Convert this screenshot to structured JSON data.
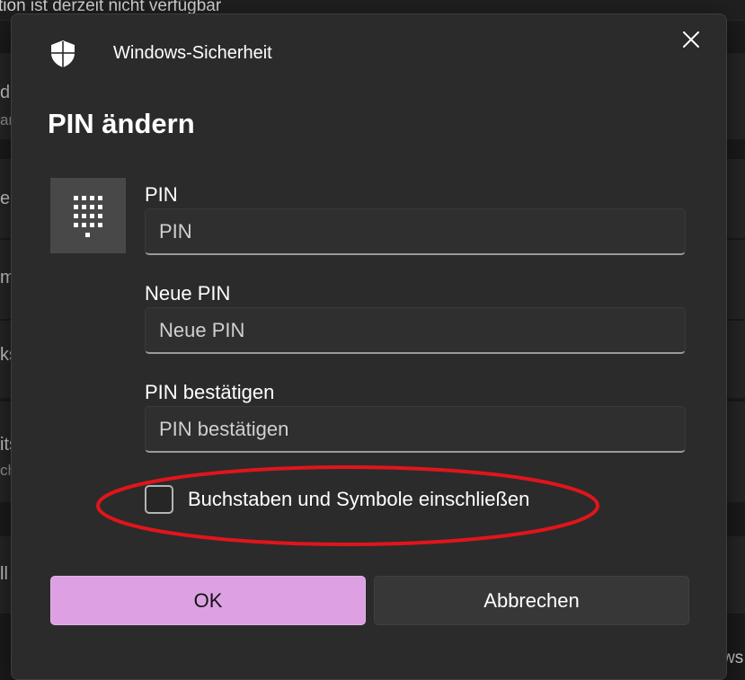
{
  "background": {
    "top_text": "tion ist derzeit nicht verfügbar",
    "fragments": [
      "d",
      "an",
      "er",
      "m",
      "ks",
      "its",
      "ch",
      "ll"
    ],
    "bottom_right_text": "ws"
  },
  "dialog": {
    "app_title": "Windows-Sicherheit",
    "heading": "PIN ändern",
    "icons": {
      "app": "shield-icon",
      "close": "close-icon",
      "keypad": "keypad-icon"
    },
    "fields": [
      {
        "label": "PIN",
        "placeholder": "PIN",
        "value": ""
      },
      {
        "label": "Neue PIN",
        "placeholder": "Neue PIN",
        "value": ""
      },
      {
        "label": "PIN bestätigen",
        "placeholder": "PIN bestätigen",
        "value": ""
      }
    ],
    "checkbox": {
      "label": "Buchstaben und Symbole einschließen",
      "checked": false
    },
    "buttons": {
      "ok": "OK",
      "cancel": "Abbrechen"
    }
  },
  "colors": {
    "accent": "#dda1e3",
    "highlight": "#e0151b",
    "dialog_bg": "#2b2b2b"
  }
}
